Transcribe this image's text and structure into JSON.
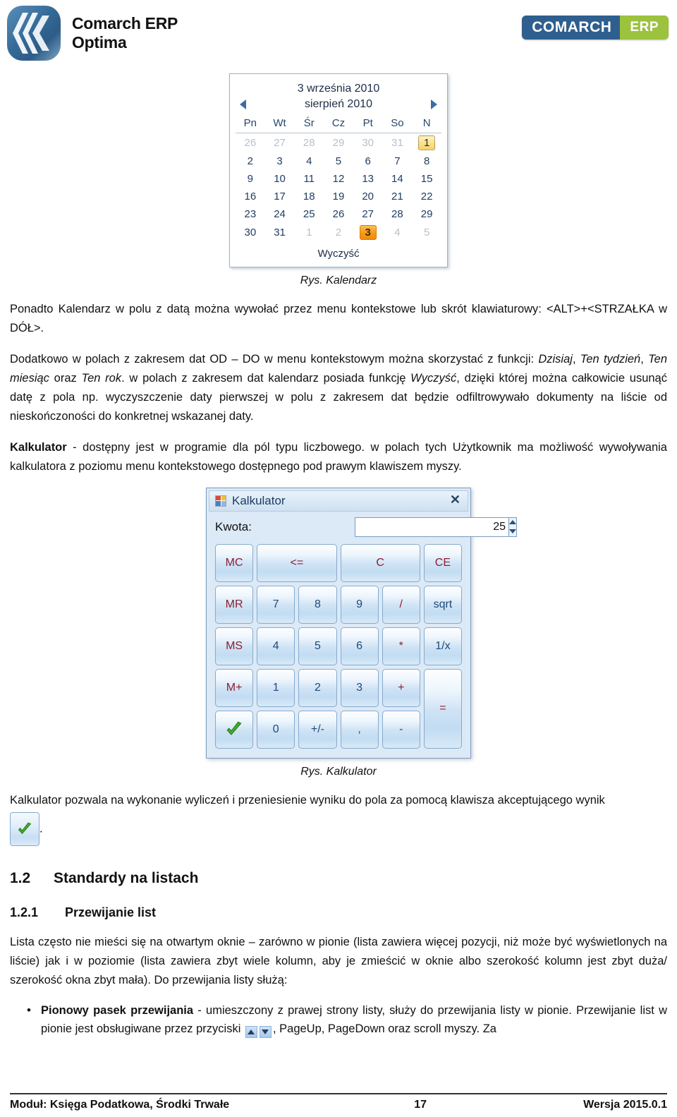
{
  "header": {
    "product_name_line1": "Comarch ERP",
    "product_name_line2": "Optima",
    "badge_left": "COMARCH",
    "badge_right": "ERP",
    "logo_icon": "comarch-chevron-logo"
  },
  "calendar": {
    "title": "3 września 2010",
    "month_label": "sierpień 2010",
    "prev_icon": "triangle-left-icon",
    "next_icon": "triangle-right-icon",
    "weekdays": [
      "Pn",
      "Wt",
      "Śr",
      "Cz",
      "Pt",
      "So",
      "N"
    ],
    "weeks": [
      [
        {
          "d": "26",
          "state": "dim"
        },
        {
          "d": "27",
          "state": "dim"
        },
        {
          "d": "28",
          "state": "dim"
        },
        {
          "d": "29",
          "state": "dim"
        },
        {
          "d": "30",
          "state": "dim"
        },
        {
          "d": "31",
          "state": "dim"
        },
        {
          "d": "1",
          "state": "focus"
        }
      ],
      [
        {
          "d": "2",
          "state": ""
        },
        {
          "d": "3",
          "state": ""
        },
        {
          "d": "4",
          "state": ""
        },
        {
          "d": "5",
          "state": ""
        },
        {
          "d": "6",
          "state": ""
        },
        {
          "d": "7",
          "state": ""
        },
        {
          "d": "8",
          "state": ""
        }
      ],
      [
        {
          "d": "9",
          "state": ""
        },
        {
          "d": "10",
          "state": ""
        },
        {
          "d": "11",
          "state": ""
        },
        {
          "d": "12",
          "state": ""
        },
        {
          "d": "13",
          "state": ""
        },
        {
          "d": "14",
          "state": ""
        },
        {
          "d": "15",
          "state": ""
        }
      ],
      [
        {
          "d": "16",
          "state": ""
        },
        {
          "d": "17",
          "state": ""
        },
        {
          "d": "18",
          "state": ""
        },
        {
          "d": "19",
          "state": ""
        },
        {
          "d": "20",
          "state": ""
        },
        {
          "d": "21",
          "state": ""
        },
        {
          "d": "22",
          "state": ""
        }
      ],
      [
        {
          "d": "23",
          "state": ""
        },
        {
          "d": "24",
          "state": ""
        },
        {
          "d": "25",
          "state": ""
        },
        {
          "d": "26",
          "state": ""
        },
        {
          "d": "27",
          "state": ""
        },
        {
          "d": "28",
          "state": ""
        },
        {
          "d": "29",
          "state": ""
        }
      ],
      [
        {
          "d": "30",
          "state": ""
        },
        {
          "d": "31",
          "state": ""
        },
        {
          "d": "1",
          "state": "dim"
        },
        {
          "d": "2",
          "state": "dim"
        },
        {
          "d": "3",
          "state": "selected"
        },
        {
          "d": "4",
          "state": "dim"
        },
        {
          "d": "5",
          "state": "dim"
        }
      ]
    ],
    "clear_label": "Wyczyść",
    "caption": "Rys. Kalendarz",
    "colors": {
      "selected_bg": "#f59a18",
      "focus_bg": "#f9e08a",
      "text": "#1f3d63",
      "border": "#9ab4cf"
    }
  },
  "paragraphs": {
    "p1_a": "Ponadto Kalendarz w polu z datą można wywołać przez menu kontekstowe lub skrót klawiaturowy: <ALT>+<STRZAŁKA w DÓŁ>.",
    "p2_part1": "Dodatkowo w polach z zakresem dat OD – DO w menu kontekstowym można skorzystać z funkcji: ",
    "p2_em1": "Dzisiaj",
    "p2_sep1": ", ",
    "p2_em2": "Ten tydzień",
    "p2_sep2": ", ",
    "p2_em3": "Ten miesiąc",
    "p2_sep3": " oraz ",
    "p2_em4": "Ten rok",
    "p2_part2": ". w polach z zakresem dat kalendarz posiada funkcję ",
    "p2_em5": "Wyczyść",
    "p2_part3": ", dzięki której można całkowicie usunąć datę z pola np. wyczyszczenie daty pierwszej w polu z zakresem dat będzie odfiltrowywało dokumenty na liście od nieskończoności do konkretnej wskazanej daty.",
    "p3_bold": "Kalkulator",
    "p3_rest": " - dostępny jest w programie dla pól typu liczbowego. w polach tych Użytkownik ma możliwość wywoływania kalkulatora z poziomu menu kontekstowego dostępnego pod prawym klawiszem myszy.",
    "p4": "Kalkulator pozwala na wykonanie wyliczeń i przeniesienie wyniku do pola za pomocą klawisza akceptującego wynik",
    "p4_end": ".",
    "p5": "Lista często nie mieści się na otwartym oknie – zarówno w pionie (lista zawiera więcej pozycji, niż może być wyświetlonych na liście) jak i w poziomie (lista zawiera zbyt wiele kolumn, aby je zmieścić w oknie albo szerokość kolumn jest zbyt duża/ szerokość okna zbyt mała). Do przewijania listy służą:"
  },
  "calculator": {
    "window_title": "Kalkulator",
    "app_icon": "windows-app-icon",
    "close_icon": "close-icon",
    "amount_label": "Kwota:",
    "amount_value": "25",
    "spinner_up_icon": "spinner-up-icon",
    "spinner_down_icon": "spinner-down-icon",
    "keys": [
      {
        "label": "MC",
        "kind": "mem",
        "span": 1,
        "name": "memory-clear"
      },
      {
        "label": "<=",
        "kind": "op",
        "span": 2,
        "name": "backspace"
      },
      {
        "label": "C",
        "kind": "op",
        "span": 2,
        "name": "clear-all"
      },
      {
        "label": "CE",
        "kind": "op",
        "span": 1,
        "name": "clear-entry"
      },
      {
        "label": "MR",
        "kind": "mem",
        "span": 1,
        "name": "memory-recall"
      },
      {
        "label": "7",
        "kind": "digit",
        "span": 1,
        "name": "digit-7"
      },
      {
        "label": "8",
        "kind": "digit",
        "span": 1,
        "name": "digit-8"
      },
      {
        "label": "9",
        "kind": "digit",
        "span": 1,
        "name": "digit-9"
      },
      {
        "label": "/",
        "kind": "op",
        "span": 1,
        "name": "divide"
      },
      {
        "label": "sqrt",
        "kind": "digit",
        "span": 1,
        "name": "square-root"
      },
      {
        "label": "MS",
        "kind": "mem",
        "span": 1,
        "name": "memory-store"
      },
      {
        "label": "4",
        "kind": "digit",
        "span": 1,
        "name": "digit-4"
      },
      {
        "label": "5",
        "kind": "digit",
        "span": 1,
        "name": "digit-5"
      },
      {
        "label": "6",
        "kind": "digit",
        "span": 1,
        "name": "digit-6"
      },
      {
        "label": "*",
        "kind": "op",
        "span": 1,
        "name": "multiply"
      },
      {
        "label": "1/x",
        "kind": "digit",
        "span": 1,
        "name": "reciprocal"
      },
      {
        "label": "M+",
        "kind": "mem",
        "span": 1,
        "name": "memory-add"
      },
      {
        "label": "1",
        "kind": "digit",
        "span": 1,
        "name": "digit-1"
      },
      {
        "label": "2",
        "kind": "digit",
        "span": 1,
        "name": "digit-2"
      },
      {
        "label": "3",
        "kind": "digit",
        "span": 1,
        "name": "digit-3"
      },
      {
        "label": "+",
        "kind": "op",
        "span": 1,
        "name": "plus"
      },
      {
        "label": "=",
        "kind": "eq",
        "span": 1,
        "name": "equals"
      },
      {
        "label": "",
        "kind": "accept",
        "span": 1,
        "name": "accept-result"
      },
      {
        "label": "0",
        "kind": "digit",
        "span": 1,
        "name": "digit-0"
      },
      {
        "label": "+/-",
        "kind": "digit",
        "span": 1,
        "name": "sign-toggle"
      },
      {
        "label": ",",
        "kind": "digit",
        "span": 1,
        "name": "decimal-comma"
      },
      {
        "label": "-",
        "kind": "op",
        "span": 1,
        "name": "minus"
      }
    ],
    "caption": "Rys. Kalkulator",
    "colors": {
      "key_text_digit": "#1f4a7a",
      "key_text_memory": "#8c1f35",
      "window_bg": "#dce9f6",
      "accept_check": "#3faa2a"
    }
  },
  "sections": {
    "sec_num": "1.2",
    "sec_title": "Standardy na listach",
    "sub_num": "1.2.1",
    "sub_title": "Przewijanie list"
  },
  "bullets": [
    {
      "bold": "Pionowy pasek przewijania",
      "rest_a": " - umieszczony z prawej strony listy, służy do przewijania listy w pionie. Przewijanie list w pionie jest obsługiwane przez przyciski ",
      "rest_b": ", PageUp, PageDown oraz scroll myszy. Za",
      "up_icon": "scroll-up-icon",
      "down_icon": "scroll-down-icon"
    }
  ],
  "footer": {
    "left": "Moduł: Księga Podatkowa, Środki Trwałe",
    "page": "17",
    "right": "Wersja 2015.0.1"
  }
}
